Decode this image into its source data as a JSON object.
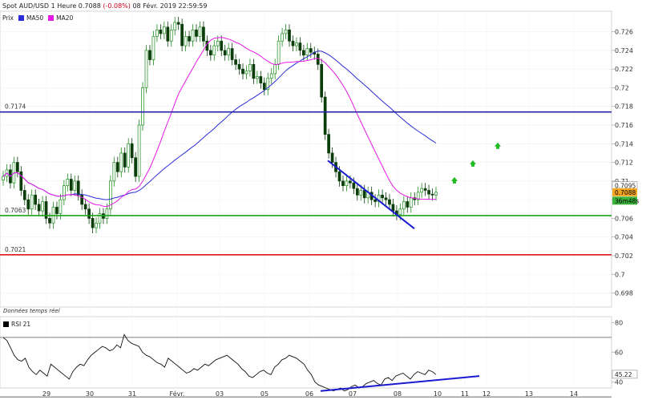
{
  "header": {
    "instrument": "Spot AUD/USD",
    "timeframe": "1 Heure",
    "last": "0.7088",
    "change": "(-0.08%)",
    "datetime": "08 Févr. 2019 22:59:59"
  },
  "legend": {
    "price": "Prix",
    "ma50": "MA50",
    "ma20": "MA20"
  },
  "rsi_label": "RSI 21",
  "realtime_note": "Données temps réel",
  "colors": {
    "ma50": "#2b2bd9",
    "ma20": "#e619e6",
    "candle_up": "#1e8c1e",
    "candle_down": "#0b3d0b",
    "resistance": "#2222aa",
    "support": "#1aa31a",
    "support2": "#e01a1a",
    "trend": "#1a1ad0",
    "arrow": "#22bb22",
    "axis_text": "#333333"
  },
  "chart_data": {
    "type": "candlestick",
    "title": "Spot AUD/USD",
    "ylim": [
      0.6965,
      0.7282
    ],
    "y_ticks": [
      "0.726",
      "0.724",
      "0.722",
      "0.72",
      "0.718",
      "0.716",
      "0.714",
      "0.712",
      "0.71",
      "0.708",
      "0.706",
      "0.704",
      "0.702",
      "0.7",
      "0.698"
    ],
    "x_ticks": [
      "29",
      "30",
      "31",
      "Févr.",
      "03",
      "05",
      "06",
      "07",
      "08",
      "10",
      "11",
      "12",
      "13",
      "14"
    ],
    "horizontal_lines": [
      {
        "value": 0.7174,
        "label": "0.7174",
        "color_key": "resistance"
      },
      {
        "value": 0.7063,
        "label": "0.7063",
        "color_key": "support"
      },
      {
        "value": 0.7021,
        "label": "0.7021",
        "color_key": "support2"
      }
    ],
    "price_tags": [
      {
        "value": 0.7095,
        "label": "0.7095"
      },
      {
        "value": 0.7088,
        "label": "0.7088"
      },
      {
        "value": 0.7079,
        "label": "36m48s"
      }
    ],
    "close_series": [
      0.7105,
      0.7112,
      0.7098,
      0.712,
      0.711,
      0.709,
      0.708,
      0.707,
      0.7085,
      0.7075,
      0.7068,
      0.7078,
      0.706,
      0.7055,
      0.7072,
      0.7065,
      0.708,
      0.7095,
      0.7102,
      0.709,
      0.71,
      0.7085,
      0.7075,
      0.707,
      0.706,
      0.705,
      0.7055,
      0.7065,
      0.706,
      0.707,
      0.71,
      0.712,
      0.711,
      0.713,
      0.7115,
      0.714,
      0.7125,
      0.7105,
      0.716,
      0.72,
      0.724,
      0.723,
      0.7255,
      0.7262,
      0.7258,
      0.7265,
      0.725,
      0.7262,
      0.727,
      0.7268,
      0.7245,
      0.7255,
      0.725,
      0.7262,
      0.7255,
      0.7265,
      0.725,
      0.724,
      0.7235,
      0.7245,
      0.725,
      0.724,
      0.7235,
      0.7242,
      0.723,
      0.7225,
      0.722,
      0.7215,
      0.7218,
      0.7225,
      0.721,
      0.7212,
      0.7205,
      0.7198,
      0.721,
      0.7215,
      0.7225,
      0.725,
      0.7258,
      0.7262,
      0.725,
      0.7245,
      0.7248,
      0.724,
      0.7235,
      0.7242,
      0.7238,
      0.7236,
      0.7225,
      0.719,
      0.715,
      0.713,
      0.712,
      0.711,
      0.71,
      0.7095,
      0.71,
      0.7098,
      0.7092,
      0.7085,
      0.709,
      0.7082,
      0.7088,
      0.708,
      0.7078,
      0.7085,
      0.7082,
      0.708,
      0.7075,
      0.7068,
      0.7064,
      0.707,
      0.7078,
      0.7072,
      0.7082,
      0.708,
      0.7088,
      0.7092,
      0.709,
      0.7086,
      0.7085,
      0.7088
    ],
    "trendline": {
      "from": [
        0.7122,
        "06"
      ],
      "to": [
        0.7049,
        "08"
      ]
    },
    "rsi": {
      "ylim": [
        36,
        84
      ],
      "y_ticks": [
        "80",
        "60",
        "40"
      ],
      "levels": [
        70,
        30
      ],
      "last_value": "45.22",
      "values": [
        70,
        68,
        63,
        58,
        55,
        54,
        56,
        50,
        47,
        45,
        48,
        46,
        44,
        52,
        50,
        48,
        46,
        44,
        42,
        47,
        50,
        52,
        51,
        55,
        58,
        60,
        62,
        64,
        63,
        61,
        62,
        65,
        63,
        72,
        68,
        66,
        65,
        64,
        60,
        58,
        57,
        55,
        53,
        52,
        50,
        56,
        54,
        52,
        50,
        48,
        46,
        47,
        49,
        48,
        50,
        52,
        51,
        53,
        55,
        56,
        57,
        58,
        56,
        54,
        52,
        49,
        47,
        44,
        43,
        45,
        47,
        48,
        46,
        45,
        50,
        52,
        55,
        56,
        58,
        57,
        56,
        54,
        52,
        48,
        45,
        40,
        38,
        37,
        36,
        35,
        34,
        35,
        36,
        34,
        35,
        37,
        38,
        36,
        37,
        39,
        40,
        41,
        39,
        38,
        42,
        43,
        41,
        44,
        45,
        46,
        44,
        42,
        45,
        47,
        46,
        45,
        48,
        47,
        45
      ]
    }
  }
}
